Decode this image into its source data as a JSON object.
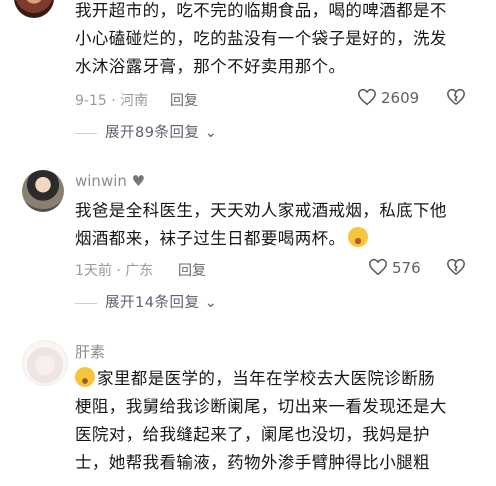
{
  "comments": [
    {
      "text_lines": [
        "我开超市的，吃不完的临期食品，喝的啤酒都是不",
        "小心磕碰烂的，吃的盐没有一个袋子是好的，洗发",
        "水沐浴露牙膏，那个不好卖用那个。"
      ],
      "meta": "9-15 · 河南",
      "reply_label": "回复",
      "likes": "2609",
      "expand": "展开89条回复"
    },
    {
      "username": "winwin",
      "text_lines": [
        "我爸是全科医生，天天劝人家戒酒戒烟，私底下他",
        "烟酒都来，袜子过生日都要喝两杯。"
      ],
      "meta": "1天前 · 广东",
      "reply_label": "回复",
      "likes": "576",
      "expand": "展开14条回复"
    },
    {
      "username": "肝素",
      "text_lines": [
        "家里都是医学的，当年在学校去大医院诊断肠",
        "梗阻，我舅给我诊断阑尾，切出来一看发现还是大",
        "医院对，给我缝起来了，阑尾也没切，我妈是护",
        "士，她帮我看输液，药物外渗手臂肿得比小腿粗"
      ]
    }
  ]
}
